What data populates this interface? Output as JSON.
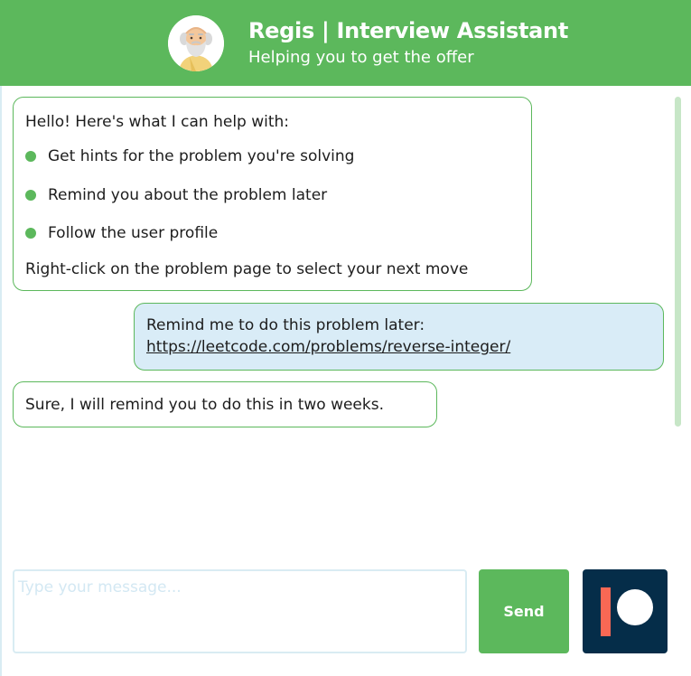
{
  "header": {
    "title": "Regis | Interview Assistant",
    "subtitle": "Helping you to get the offer",
    "avatar_icon": "old-man-avatar-icon",
    "background_color": "#5cb85c"
  },
  "chat": {
    "bot_intro": {
      "intro": "Hello! Here's what I can help with:",
      "items": [
        "Get hints for the problem you're solving",
        "Remind you about the problem later",
        "Follow the user profile"
      ],
      "outro": "Right-click on the problem page to select your next move"
    },
    "user_message": {
      "text": "Remind me to do this problem later:",
      "link": "https://leetcode.com/problems/reverse-integer/"
    },
    "bot_reply": "Sure, I will remind you to do this in two weeks."
  },
  "composer": {
    "placeholder": "Type your message...",
    "send_label": "Send",
    "patreon_icon": "patreon-icon"
  },
  "colors": {
    "accent": "#5cb85c",
    "user_bubble": "#d9ecf7",
    "patreon_bg": "#052d49",
    "patreon_bar": "#f96854"
  }
}
